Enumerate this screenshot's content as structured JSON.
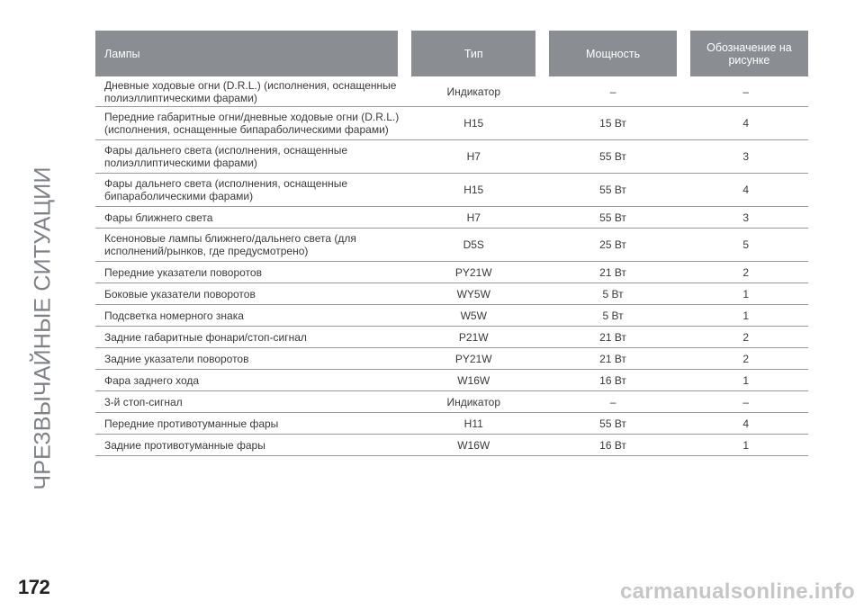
{
  "side_title": "ЧРЕЗВЫЧАЙНЫЕ СИТУАЦИИ",
  "page_number": "172",
  "watermark": "carmanualsonline.info",
  "table": {
    "headers": {
      "lamp": "Лампы",
      "type": "Тип",
      "power": "Мощность",
      "figure": "Обозначение на рисунке"
    },
    "rows": [
      {
        "lamp": "Дневные ходовые огни (D.R.L.) (исполнения, оснащенные полиэллиптическими фарами)",
        "type": "Индикатор",
        "power": "–",
        "figure": "–"
      },
      {
        "lamp": "Передние габаритные огни/дневные ходовые огни (D.R.L.) (исполнения, оснащенные бипараболическими фарами)",
        "type": "H15",
        "power": "15 Вт",
        "figure": "4"
      },
      {
        "lamp": "Фары дальнего света (исполнения, оснащенные полиэллиптическими фарами)",
        "type": "H7",
        "power": "55 Вт",
        "figure": "3"
      },
      {
        "lamp": "Фары дальнего света (исполнения, оснащенные бипараболическими фарами)",
        "type": "H15",
        "power": "55 Вт",
        "figure": "4"
      },
      {
        "lamp": "Фары ближнего света",
        "type": "H7",
        "power": "55 Вт",
        "figure": "3"
      },
      {
        "lamp": "Ксеноновые лампы ближнего/дальнего света (для исполнений/рынков, где предусмотрено)",
        "type": "D5S",
        "power": "25 Вт",
        "figure": "5"
      },
      {
        "lamp": "Передние указатели поворотов",
        "type": "PY21W",
        "power": "21 Вт",
        "figure": "2"
      },
      {
        "lamp": "Боковые указатели поворотов",
        "type": "WY5W",
        "power": "5 Вт",
        "figure": "1"
      },
      {
        "lamp": "Подсветка номерного знака",
        "type": "W5W",
        "power": "5 Вт",
        "figure": "1"
      },
      {
        "lamp": "Задние габаритные фонари/стоп-сигнал",
        "type": "P21W",
        "power": "21 Вт",
        "figure": "2"
      },
      {
        "lamp": "Задние указатели поворотов",
        "type": "PY21W",
        "power": "21 Вт",
        "figure": "2"
      },
      {
        "lamp": "Фара заднего хода",
        "type": "W16W",
        "power": "16 Вт",
        "figure": "1"
      },
      {
        "lamp": "3-й стоп-сигнал",
        "type": "Индикатор",
        "power": "–",
        "figure": "–"
      },
      {
        "lamp": "Передние противотуманные фары",
        "type": "H11",
        "power": "55 Вт",
        "figure": "4"
      },
      {
        "lamp": "Задние противотуманные фары",
        "type": "W16W",
        "power": "16 Вт",
        "figure": "1"
      }
    ]
  }
}
